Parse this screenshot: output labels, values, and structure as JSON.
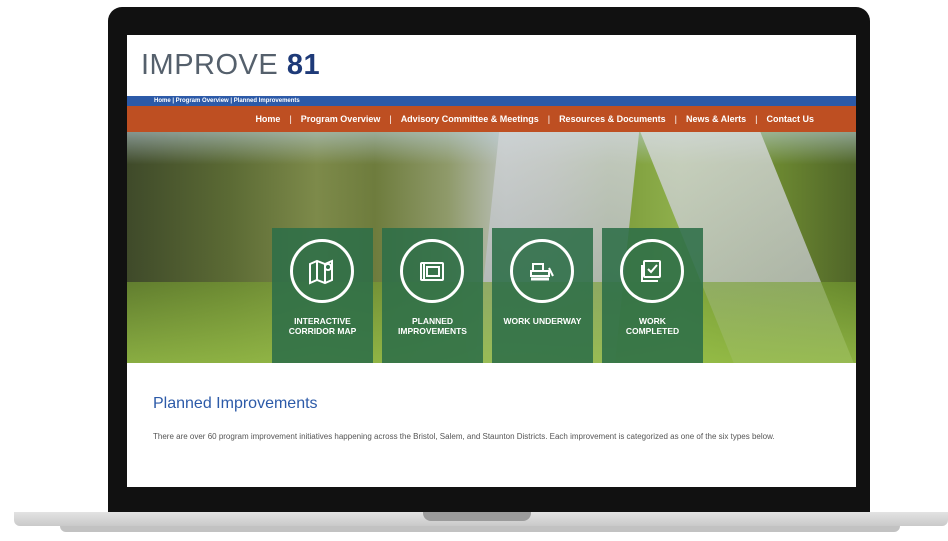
{
  "site": {
    "logo_text": "IMPROVE",
    "logo_number": "81",
    "breadcrumb": "Home | Program Overview | Planned Improvements"
  },
  "nav": {
    "items": [
      {
        "label": "Home"
      },
      {
        "label": "Program Overview"
      },
      {
        "label": "Advisory Committee & Meetings"
      },
      {
        "label": "Resources & Documents"
      },
      {
        "label": "News & Alerts"
      },
      {
        "label": "Contact Us"
      }
    ],
    "separator": "|"
  },
  "tiles": [
    {
      "label": "INTERACTIVE\nCORRIDOR MAP",
      "icon": "map-pin-icon"
    },
    {
      "label": "PLANNED\nIMPROVEMENTS",
      "icon": "blueprint-icon"
    },
    {
      "label": "WORK UNDERWAY",
      "icon": "bulldozer-icon"
    },
    {
      "label": "WORK\nCOMPLETED",
      "icon": "checkbox-icon"
    }
  ],
  "main": {
    "heading": "Planned Improvements",
    "body": "There are over 60 program improvement initiatives happening across the Bristol, Salem, and Staunton Districts. Each improvement is categorized as one of the six types below."
  },
  "colors": {
    "header_blue": "#2c5aa8",
    "nav_orange": "#be4f22",
    "tile_green": "#2e6e48",
    "logo_navy": "#1e3a78"
  }
}
